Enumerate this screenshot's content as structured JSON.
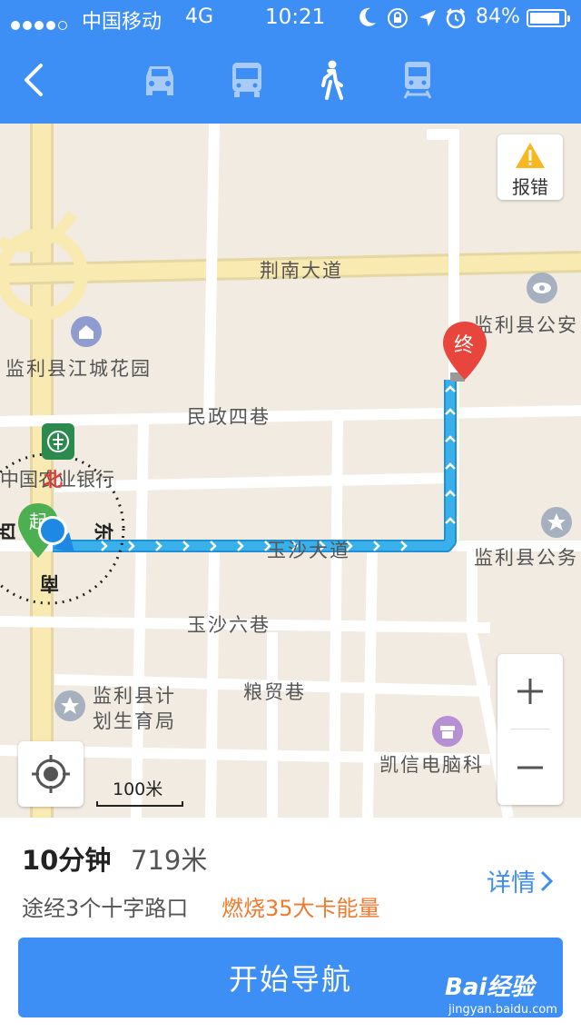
{
  "status_bar": {
    "carrier": "中国移动",
    "network": "4G",
    "time": "10:21",
    "battery": "84%"
  },
  "nav": {
    "modes": [
      {
        "name": "car",
        "icon": "car-icon"
      },
      {
        "name": "bus",
        "icon": "bus-icon"
      },
      {
        "name": "walk",
        "icon": "walk-icon",
        "selected": true
      },
      {
        "name": "train",
        "icon": "train-icon"
      }
    ],
    "accent": "#3d8ef5"
  },
  "map": {
    "report_label": "报错",
    "end_marker": "终",
    "compass": {
      "north": "北",
      "south": "南",
      "east": "东",
      "west": "西",
      "start_char": "起"
    },
    "roads": {
      "jingnan": "荆南大道",
      "minzheng": "民政四巷",
      "yusha": "玉沙大道",
      "yusha6": "玉沙六巷",
      "liangmao": "粮贸巷"
    },
    "pois": {
      "jiangcheng": "监利县江城花园",
      "bank": "中国农业银行",
      "police": "监利县公安",
      "gov": "监利县公务",
      "jihua_line1": "监利县计",
      "jihua_line2": "划生育局",
      "kaixin": "凯信电脑科"
    },
    "scale": "100米",
    "route_color": "#3ab0ea"
  },
  "summary": {
    "time": "10分钟",
    "distance": "719米",
    "via": "途经3个十字路口",
    "burn": "燃烧35大卡能量",
    "details": "详情",
    "start": "开始导航"
  },
  "watermark": {
    "logo": "Bai经验",
    "url": "jingyan.baidu.com"
  }
}
